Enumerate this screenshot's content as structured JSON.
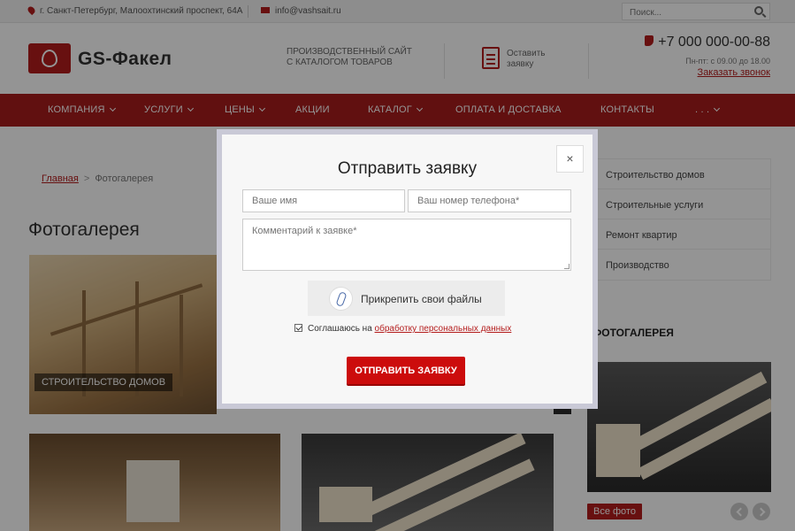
{
  "topbar": {
    "address": "г. Санкт-Петербург, Малоохтинский проспект, 64А",
    "email": "info@vashsait.ru",
    "search_placeholder": "Поиск..."
  },
  "header": {
    "logo_text": "GS-Факел",
    "slogan_line1": "ПРОИЗВОДСТВЕННЫЙ САЙТ",
    "slogan_line2": "С КАТАЛОГОМ ТОВАРОВ",
    "order_line1": "Оставить",
    "order_line2": "заявку",
    "phone": "+7 000 000-00-88",
    "hours": "Пн-пт: с 09.00 до 18.00",
    "callback": "Заказать звонок"
  },
  "nav": {
    "items": [
      {
        "label": "Компания"
      },
      {
        "label": "Услуги"
      },
      {
        "label": "Цены"
      },
      {
        "label": "Акции"
      },
      {
        "label": "Каталог"
      },
      {
        "label": "Оплата и доставка"
      },
      {
        "label": "Контакты"
      },
      {
        "label": ". . ."
      }
    ]
  },
  "breadcrumb": {
    "home": "Главная",
    "separator": ">",
    "current": "Фотогалерея"
  },
  "page": {
    "title": "Фотогалерея",
    "gallery_caption_1": "Строительство домов"
  },
  "sidebar": {
    "items": [
      {
        "label": "Строительство домов"
      },
      {
        "label": "Строительные услуги"
      },
      {
        "label": "Ремонт квартир"
      },
      {
        "label": "Производство"
      }
    ],
    "gallery_heading": "Фотогалерея",
    "all_photo": "Все фото"
  },
  "modal": {
    "title": "Отправить заявку",
    "close": "×",
    "name_placeholder": "Ваше имя",
    "phone_placeholder": "Ваш номер телефона*",
    "comment_placeholder": "Комментарий к заявке*",
    "attach_label": "Прикрепить свои файлы",
    "consent_text": "Соглашаюсь на",
    "consent_link": "обработку персональных данных",
    "submit_label": "Отправить заявку"
  },
  "colors": {
    "brand": "#a81c1c",
    "submit": "#cc0c0c"
  }
}
